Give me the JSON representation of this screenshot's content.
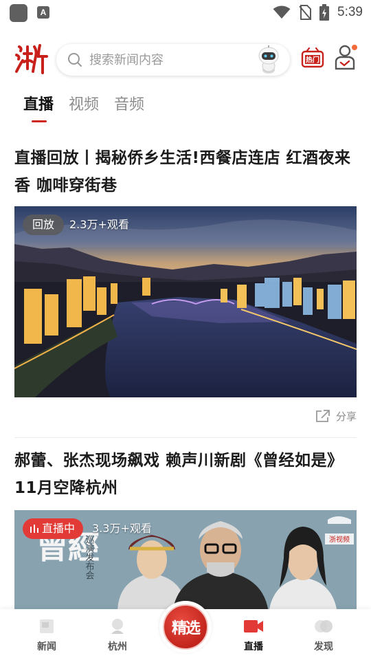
{
  "status_bar": {
    "time": "5:39",
    "notification_icon": "A",
    "icons": [
      "wifi-icon",
      "no-sim-icon",
      "battery-charging-icon"
    ]
  },
  "header": {
    "logo_text": "浙",
    "search_placeholder": "搜索新闻内容",
    "hot_label": "热门"
  },
  "tabs": [
    {
      "label": "直播",
      "active": true
    },
    {
      "label": "视频",
      "active": false
    },
    {
      "label": "音频",
      "active": false
    }
  ],
  "articles": [
    {
      "title": "直播回放丨揭秘侨乡生活!西餐店连店 红酒夜来香 咖啡穿街巷",
      "badge": "回放",
      "viewers": "2.3万+观看",
      "share_label": "分享"
    },
    {
      "title": "郝蕾、张杰现场飙戏 赖声川新剧《曾经如是》11月空降杭州",
      "badge": "直播中",
      "viewers": "3.3万+观看",
      "poster_title": "曾經",
      "poster_subtitle": "巡演发布会",
      "poster_brand": "浙视频"
    }
  ],
  "bottom_nav": [
    {
      "label": "新闻",
      "icon": "news-icon",
      "active": false
    },
    {
      "label": "杭州",
      "icon": "hangzhou-icon",
      "active": false
    },
    {
      "label": "精选",
      "icon": "featured-icon",
      "active": false
    },
    {
      "label": "直播",
      "icon": "live-camera-icon",
      "active": true
    },
    {
      "label": "发现",
      "icon": "discover-icon",
      "active": false
    }
  ],
  "colors": {
    "accent": "#d0261f",
    "live_badge": "#e23a36",
    "text": "#1a1a1a",
    "muted": "#8c8c8c"
  }
}
